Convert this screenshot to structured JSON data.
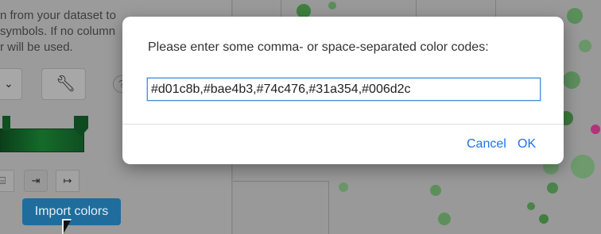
{
  "background": {
    "help_lines": [
      "n from your dataset to",
      "symbols. If no column",
      "r will be used."
    ],
    "help_icon": "?",
    "dropdown_icon": "chevron-down-icon",
    "wrench_icon": "wrench-icon",
    "small_buttons": [
      {
        "icon": "file-icon",
        "glyph": "⌸"
      },
      {
        "icon": "import-icon",
        "glyph": "⇥"
      },
      {
        "icon": "export-icon",
        "glyph": "↦"
      }
    ],
    "import_colors_label": "Import colors",
    "colors": {
      "ramp_dark": "#0b3f1a",
      "ramp_mid": "#156b2a",
      "import_button": "#1f6d9c",
      "dot_green": "#1f8a2e",
      "dot_magenta": "#c0206f"
    }
  },
  "dialog": {
    "message": "Please enter some comma- or space-separated color codes:",
    "input_value": "#d01c8b,#bae4b3,#74c476,#31a354,#006d2c",
    "cancel_label": "Cancel",
    "ok_label": "OK",
    "accent_color": "#1a73e8"
  }
}
